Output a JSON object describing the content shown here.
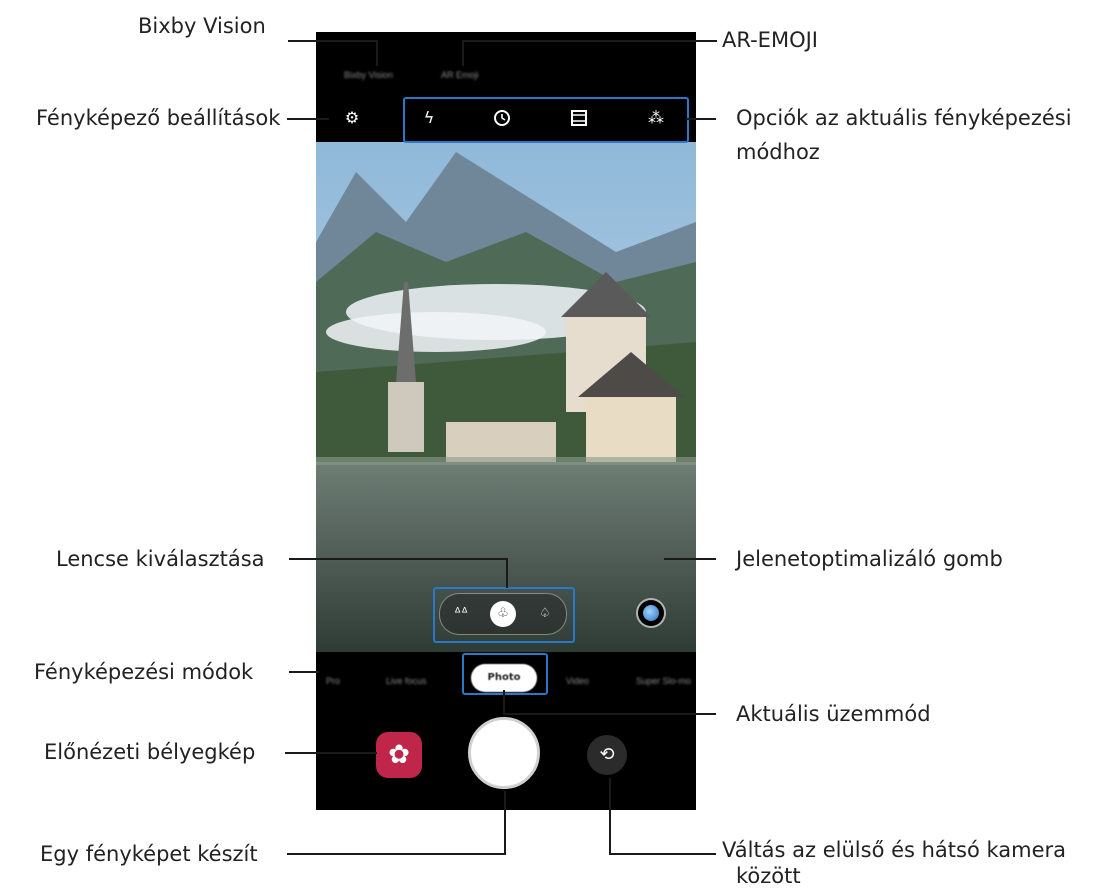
{
  "callouts": {
    "bixby_vision": "Bixby Vision",
    "ar_emoji": "AR-EMOJI",
    "camera_settings": "Fényképező beállítások",
    "current_mode_options_line1": "Opciók az aktuális fényképezési",
    "current_mode_options_line2": "módhoz",
    "lens_selection": "Lencse kiválasztása",
    "scene_optimizer": "Jelenetoptimalizáló gomb",
    "shooting_modes": "Fényképezési módok",
    "current_mode": "Aktuális üzemmód",
    "preview_thumbnail": "Előnézeti bélyegkép",
    "take_photo": "Egy fényképet készít",
    "switch_camera_line1": "Váltás az elülső és hátsó kamera",
    "switch_camera_line2": "között"
  },
  "phone": {
    "top_tabs": [
      "Bixby Vision",
      "AR Emoji"
    ],
    "options_icons": [
      "flash-off-icon",
      "timer-icon",
      "aspect-ratio-icon",
      "filter-icon"
    ],
    "modes": [
      "Pro",
      "Live focus",
      "Photo",
      "Video",
      "Super Slo-mo"
    ],
    "current_mode": "Photo"
  },
  "colors": {
    "highlight": "#2a78c8",
    "thumbnail": "#c0254a"
  }
}
